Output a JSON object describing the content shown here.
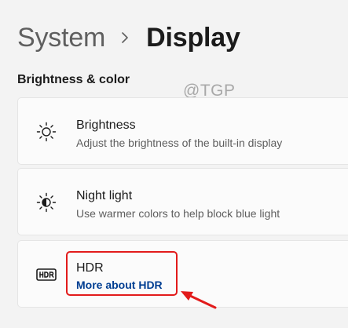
{
  "breadcrumb": {
    "parent": "System",
    "current": "Display"
  },
  "section": {
    "title": "Brightness & color"
  },
  "watermark": "@TGP",
  "settings": [
    {
      "title": "Brightness",
      "description": "Adjust the brightness of the built-in display",
      "icon": "sun-icon"
    },
    {
      "title": "Night light",
      "description": "Use warmer colors to help block blue light",
      "icon": "night-light-icon"
    },
    {
      "title": "HDR",
      "link": "More about HDR",
      "icon": "hdr-icon"
    }
  ],
  "annotation": {
    "color": "#e21b1b"
  },
  "colors": {
    "background": "#f3f3f3",
    "card": "#fbfbfb",
    "link": "#003e92"
  }
}
